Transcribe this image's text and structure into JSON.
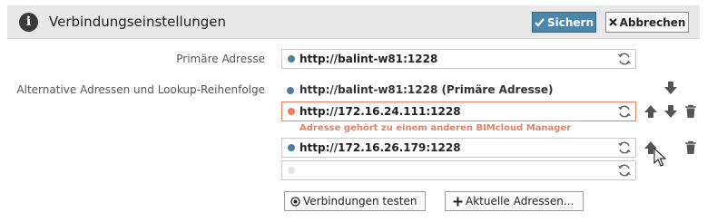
{
  "header": {
    "title": "Verbindungseinstellungen",
    "save_label": "Sichern",
    "cancel_label": "Abbrechen"
  },
  "primary": {
    "label": "Primäre Adresse",
    "value": "http://balint-w81:1228"
  },
  "alternatives": {
    "label": "Alternative Adressen und Lookup-Reihenfolge",
    "primary_entry": "http://balint-w81:1228 (Primäre Adresse)",
    "rows": [
      {
        "value": "http://172.16.24.111:1228",
        "status": "error"
      },
      {
        "value": "http://172.16.26.179:1228",
        "status": "ok"
      },
      {
        "value": "",
        "status": "empty"
      }
    ],
    "error_message": "Adresse gehört zu einem anderen BIMcloud Manager"
  },
  "footer": {
    "test_label": "Verbindungen testen",
    "add_label": "Aktuelle Adressen..."
  },
  "colors": {
    "accent": "#4b86ad",
    "ok_dot": "#4a7fa6",
    "error": "#e8805f",
    "header_bg": "#e8e8e8"
  }
}
